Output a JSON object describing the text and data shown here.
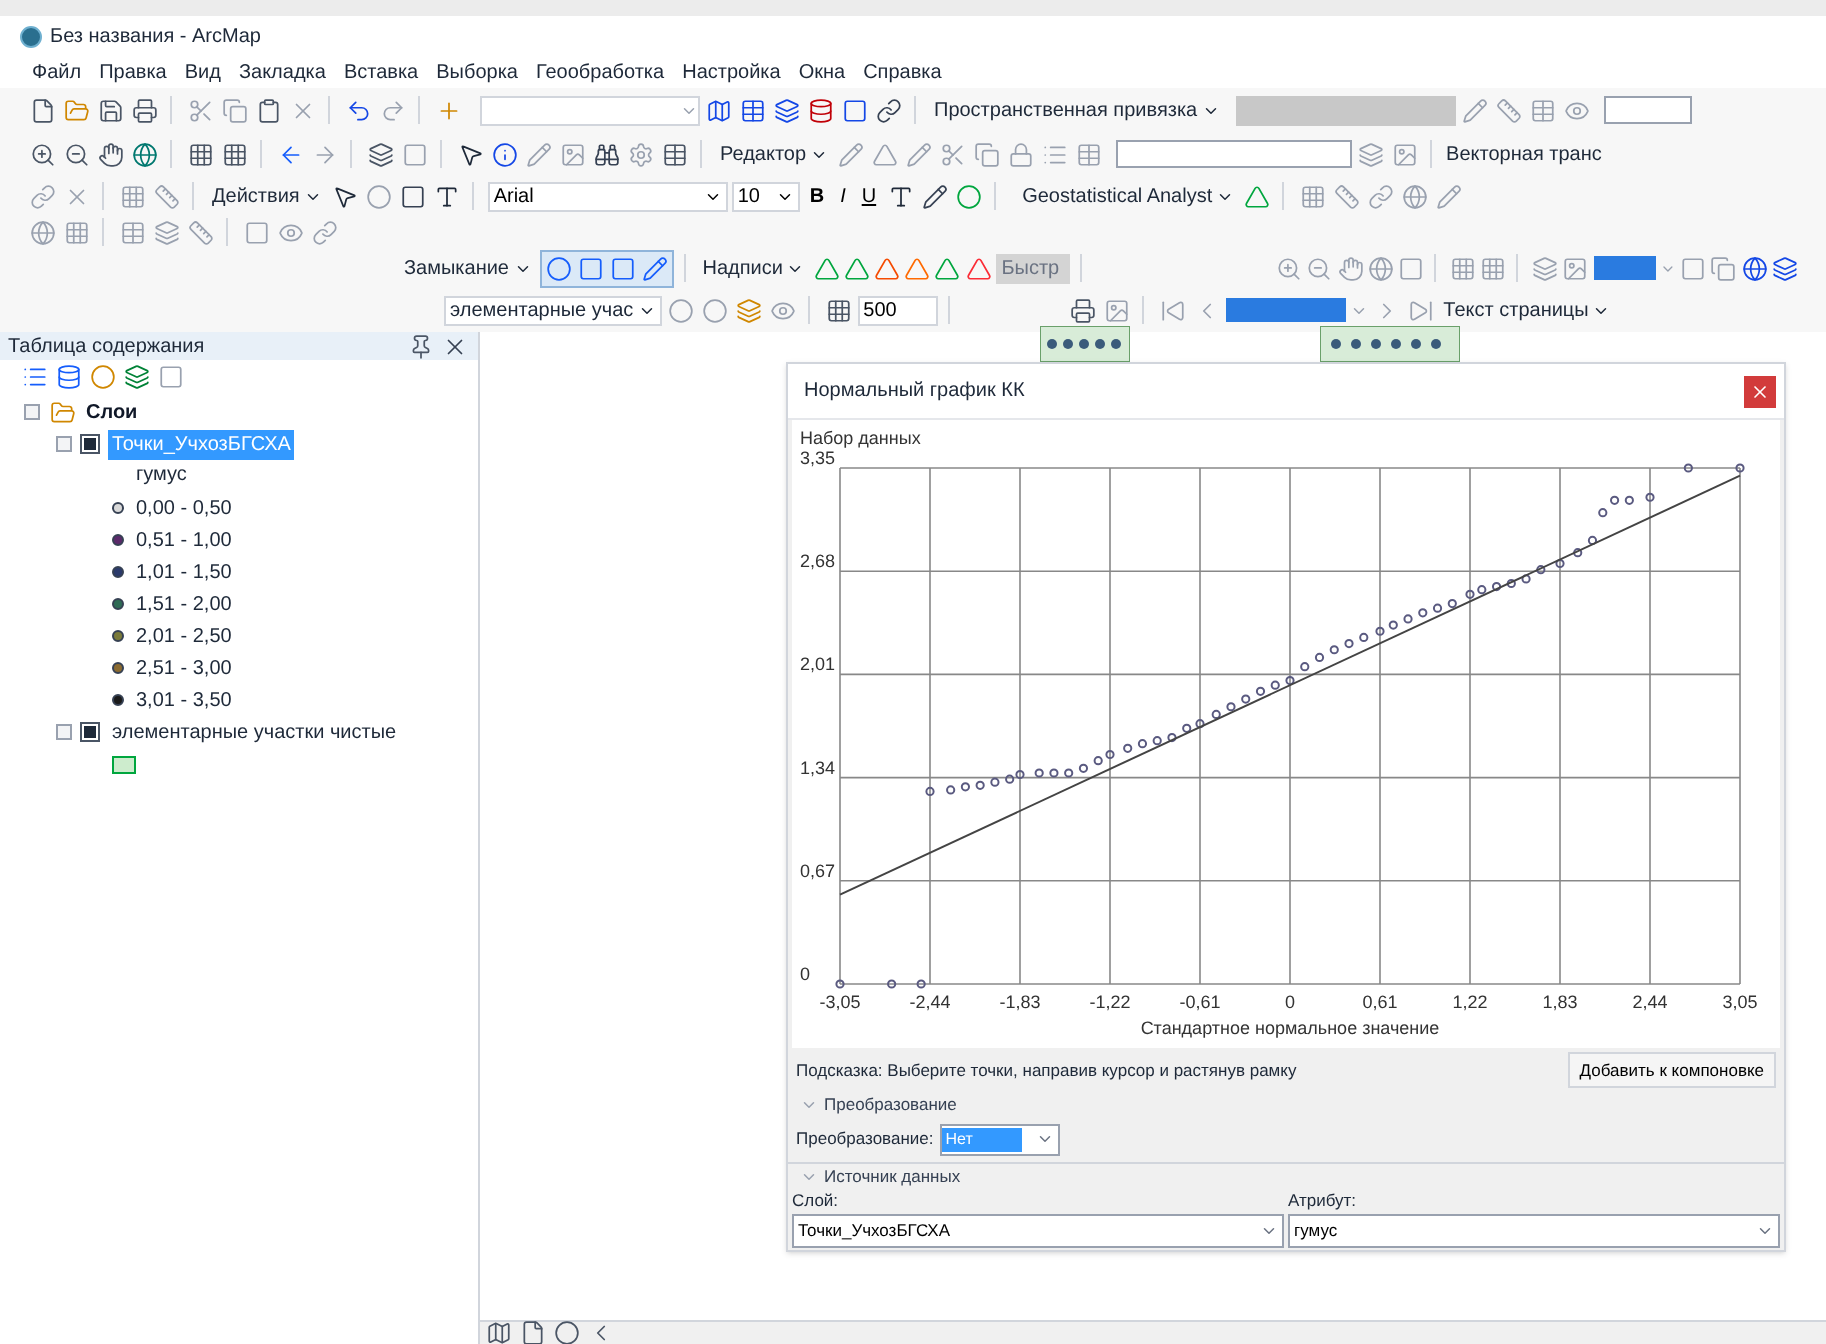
{
  "window": {
    "title": "Без названия - ArcMap"
  },
  "menu": [
    "Файл",
    "Правка",
    "Вид",
    "Закладка",
    "Вставка",
    "Выборка",
    "Геообработка",
    "Настройка",
    "Окна",
    "Справка"
  ],
  "toolbars": {
    "georef": {
      "label": "Пространственная привязка"
    },
    "editor": {
      "label": "Редактор",
      "vector": "Векторная транс"
    },
    "draw": {
      "label": "Действия",
      "font": "Arial",
      "size": "10",
      "bold": "B",
      "italic": "I",
      "underline": "U",
      "geostat": "Geostatistical Analyst"
    },
    "snapping": {
      "label": "Замыкание",
      "labels": "Надписи",
      "quick": "Быстр"
    },
    "effects": {
      "layer": "элементарные учас",
      "scale": "500",
      "page_text": "Текст страницы"
    }
  },
  "toc": {
    "title": "Таблица содержания",
    "root": {
      "label": "Слои",
      "expanded": true,
      "children": [
        {
          "label": "Точки_УчхозБГСХА",
          "checked": true,
          "selected": true,
          "expanded": true,
          "legend": {
            "field": "гумус",
            "classes": [
              {
                "label": "0,00 - 0,50",
                "color": "#d9d9d9"
              },
              {
                "label": "0,51 - 1,00",
                "color": "#5b2a6a"
              },
              {
                "label": "1,01 - 1,50",
                "color": "#2b3a6b"
              },
              {
                "label": "1,51 - 2,00",
                "color": "#2f6b55"
              },
              {
                "label": "2,01 - 2,50",
                "color": "#7a7a3a"
              },
              {
                "label": "2,51 - 3,00",
                "color": "#8a6a30"
              },
              {
                "label": "3,01 - 3,50",
                "color": "#1a1a1a"
              }
            ]
          }
        },
        {
          "label": "элементарные участки чистые",
          "checked": true,
          "selected": false,
          "expanded": true,
          "legend": {
            "classes": [
              {
                "color": "#cdeccd"
              }
            ]
          }
        }
      ]
    }
  },
  "dialog": {
    "title": "Нормальный график КК",
    "chart_data": {
      "type": "scatter",
      "ylabel": "Набор данных",
      "xlabel": "Стандартное нормальное значение",
      "xlim": [
        -3.05,
        3.05
      ],
      "ylim": [
        0,
        3.35
      ],
      "xticks": [
        {
          "value": -3.05,
          "label": "-3,05"
        },
        {
          "value": -2.44,
          "label": "-2,44"
        },
        {
          "value": -1.83,
          "label": "-1,83"
        },
        {
          "value": -1.22,
          "label": "-1,22"
        },
        {
          "value": -0.61,
          "label": "-0,61"
        },
        {
          "value": 0,
          "label": "0"
        },
        {
          "value": 0.61,
          "label": "0,61"
        },
        {
          "value": 1.22,
          "label": "1,22"
        },
        {
          "value": 1.83,
          "label": "1,83"
        },
        {
          "value": 2.44,
          "label": "2,44"
        },
        {
          "value": 3.05,
          "label": "3,05"
        }
      ],
      "yticks": [
        {
          "value": 0,
          "label": "0"
        },
        {
          "value": 0.67,
          "label": "0,67"
        },
        {
          "value": 1.34,
          "label": "1,34"
        },
        {
          "value": 2.01,
          "label": "2,01"
        },
        {
          "value": 2.68,
          "label": "2,68"
        },
        {
          "value": 3.35,
          "label": "3,35"
        }
      ],
      "grid": true,
      "series": [
        {
          "color": "#5a5a80",
          "x": [
            -3.05,
            -2.7,
            -2.5,
            -2.44,
            -2.3,
            -2.2,
            -2.1,
            -2.0,
            -1.9,
            -1.83,
            -1.7,
            -1.6,
            -1.5,
            -1.4,
            -1.3,
            -1.22,
            -1.1,
            -1.0,
            -0.9,
            -0.8,
            -0.7,
            -0.61,
            -0.5,
            -0.4,
            -0.3,
            -0.2,
            -0.1,
            0,
            0.1,
            0.2,
            0.3,
            0.4,
            0.5,
            0.61,
            0.7,
            0.8,
            0.9,
            1.0,
            1.1,
            1.22,
            1.3,
            1.4,
            1.5,
            1.6,
            1.7,
            1.83,
            1.95,
            2.05,
            2.12,
            2.2,
            2.3,
            2.44,
            2.7,
            3.05
          ],
          "values": [
            0,
            0,
            0,
            1.25,
            1.26,
            1.28,
            1.29,
            1.31,
            1.33,
            1.36,
            1.37,
            1.37,
            1.37,
            1.4,
            1.45,
            1.49,
            1.53,
            1.56,
            1.58,
            1.6,
            1.66,
            1.69,
            1.75,
            1.8,
            1.85,
            1.9,
            1.94,
            1.97,
            2.06,
            2.12,
            2.17,
            2.21,
            2.25,
            2.29,
            2.33,
            2.37,
            2.41,
            2.44,
            2.47,
            2.53,
            2.56,
            2.58,
            2.6,
            2.63,
            2.69,
            2.73,
            2.8,
            2.88,
            3.06,
            3.14,
            3.14,
            3.16,
            3.35,
            3.35
          ]
        },
        {
          "type": "line",
          "color": "#444444",
          "x": [
            -3.05,
            3.05
          ],
          "values": [
            0.58,
            3.3
          ]
        }
      ]
    },
    "hint": "Подсказка: Выберите точки, направив курсор и растянув рамку",
    "add_button": "Добавить к компоновке",
    "transform_section": {
      "title": "Преобразование",
      "expanded": true,
      "label": "Преобразование:",
      "value": "Нет"
    },
    "source_section": {
      "title": "Источник данных",
      "expanded": true,
      "layer_label": "Слой:",
      "layer": "Точки_УчхозБГСХА",
      "attribute_label": "Атрибут:",
      "attribute": "гумус"
    }
  }
}
